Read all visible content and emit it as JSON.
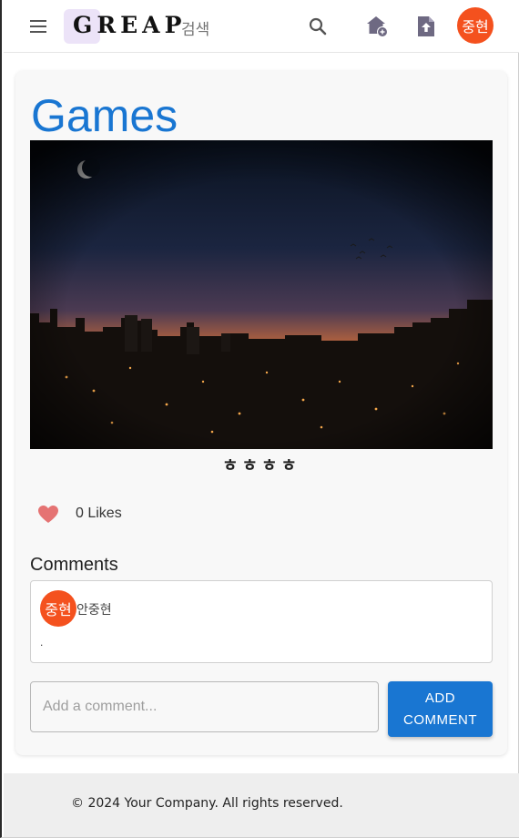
{
  "header": {
    "logo_text": "GREAP",
    "search_label": "검색",
    "icons": [
      "menu-icon",
      "search-icon",
      "home-add-icon",
      "file-upload-icon"
    ],
    "user_avatar": "중현",
    "avatar_color": "#f4511e"
  },
  "post": {
    "title": "Games",
    "title_color": "#1976d2",
    "caption": "ㅎㅎㅎㅎ",
    "likes_text": "0 Likes",
    "like_color": "#e57373"
  },
  "comments": {
    "heading": "Comments",
    "items": [
      {
        "avatar": "중현",
        "author": "안중현",
        "body": "."
      }
    ],
    "input_placeholder": "Add a comment...",
    "add_button_label": "ADD COMMENT",
    "button_color": "#1976d2"
  },
  "footer": {
    "text": "© 2024 Your Company. All rights reserved."
  }
}
